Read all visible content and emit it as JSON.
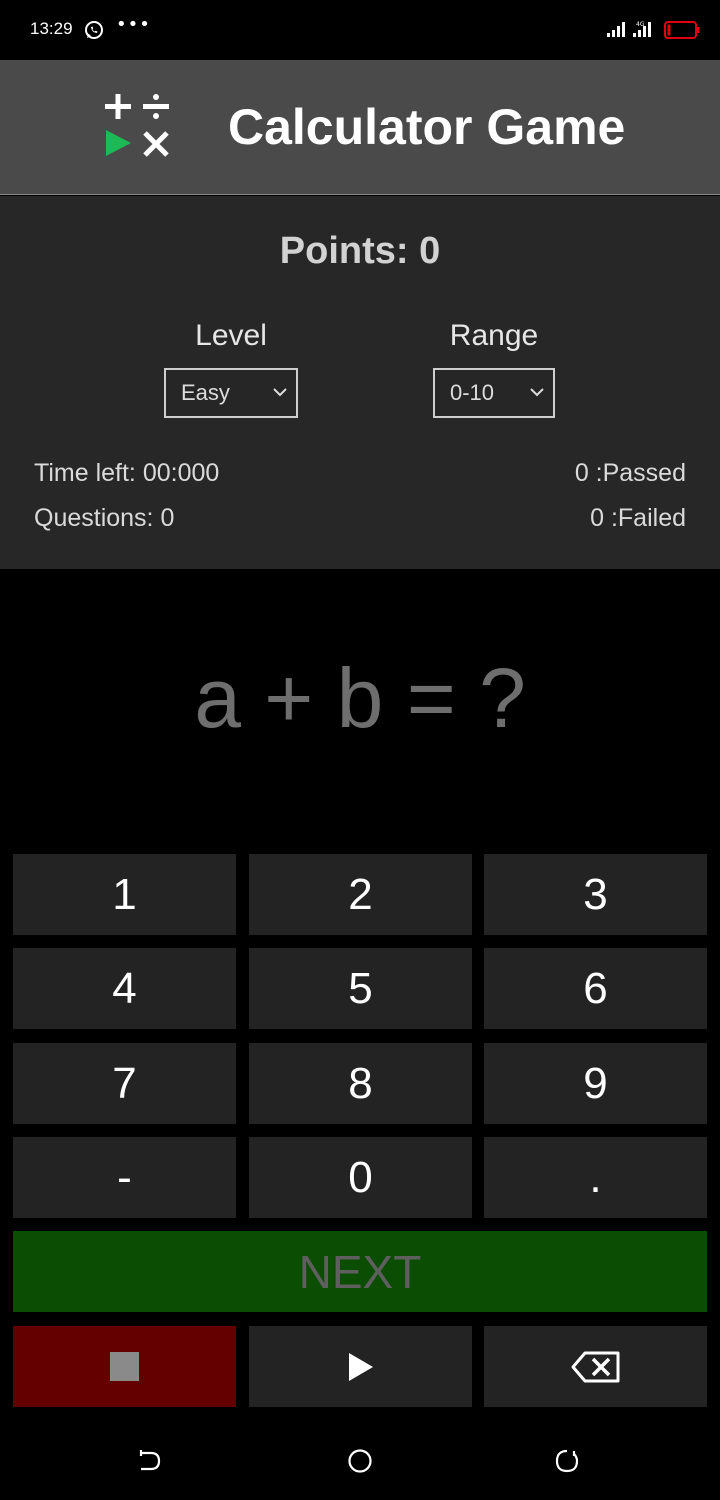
{
  "status_bar": {
    "time": "13:29",
    "more": "•••",
    "network": "4G"
  },
  "header": {
    "title": "Calculator Game",
    "logo_icon": "math-operations-play-logo",
    "logo_colors": {
      "symbols": "#ffffff",
      "play": "#1db954"
    }
  },
  "scoreboard": {
    "points": "Points: 0",
    "level_label": "Level",
    "level_value": "Easy",
    "range_label": "Range",
    "range_value": "0-10",
    "time_left": "Time left: 00:000",
    "questions": "Questions: 0",
    "passed": "0 :Passed",
    "failed": "0 :Failed"
  },
  "equation": "a + b = ?",
  "keypad": {
    "keys": [
      "1",
      "2",
      "3",
      "4",
      "5",
      "6",
      "7",
      "8",
      "9",
      "-",
      "0",
      "."
    ],
    "next_label": "NEXT",
    "controls": [
      "stop-icon",
      "play-icon",
      "backspace-icon"
    ]
  },
  "colors": {
    "header_bg": "#4a4a4a",
    "panel_bg": "#272727",
    "key_bg": "#232323",
    "next_bg": "#0b4d02",
    "stop_bg": "#640000"
  }
}
